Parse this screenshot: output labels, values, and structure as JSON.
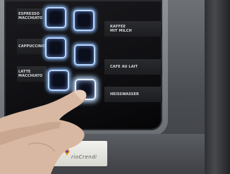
{
  "machine": {
    "left_labels": [
      "ESPRESSO\nMACCHIATO",
      "CAPPUCCINO",
      "LATTE MACCHIATO"
    ],
    "right_labels": [
      "KAFFEE\nMIT MILCH",
      "CAFE AU LAIT",
      "HEISSWASSER"
    ],
    "pressed_button": "HEISSWASSER",
    "brand": "rioCrendi",
    "button_glow_color": "#b9d6ff",
    "panel_color": "#0d0d10"
  }
}
